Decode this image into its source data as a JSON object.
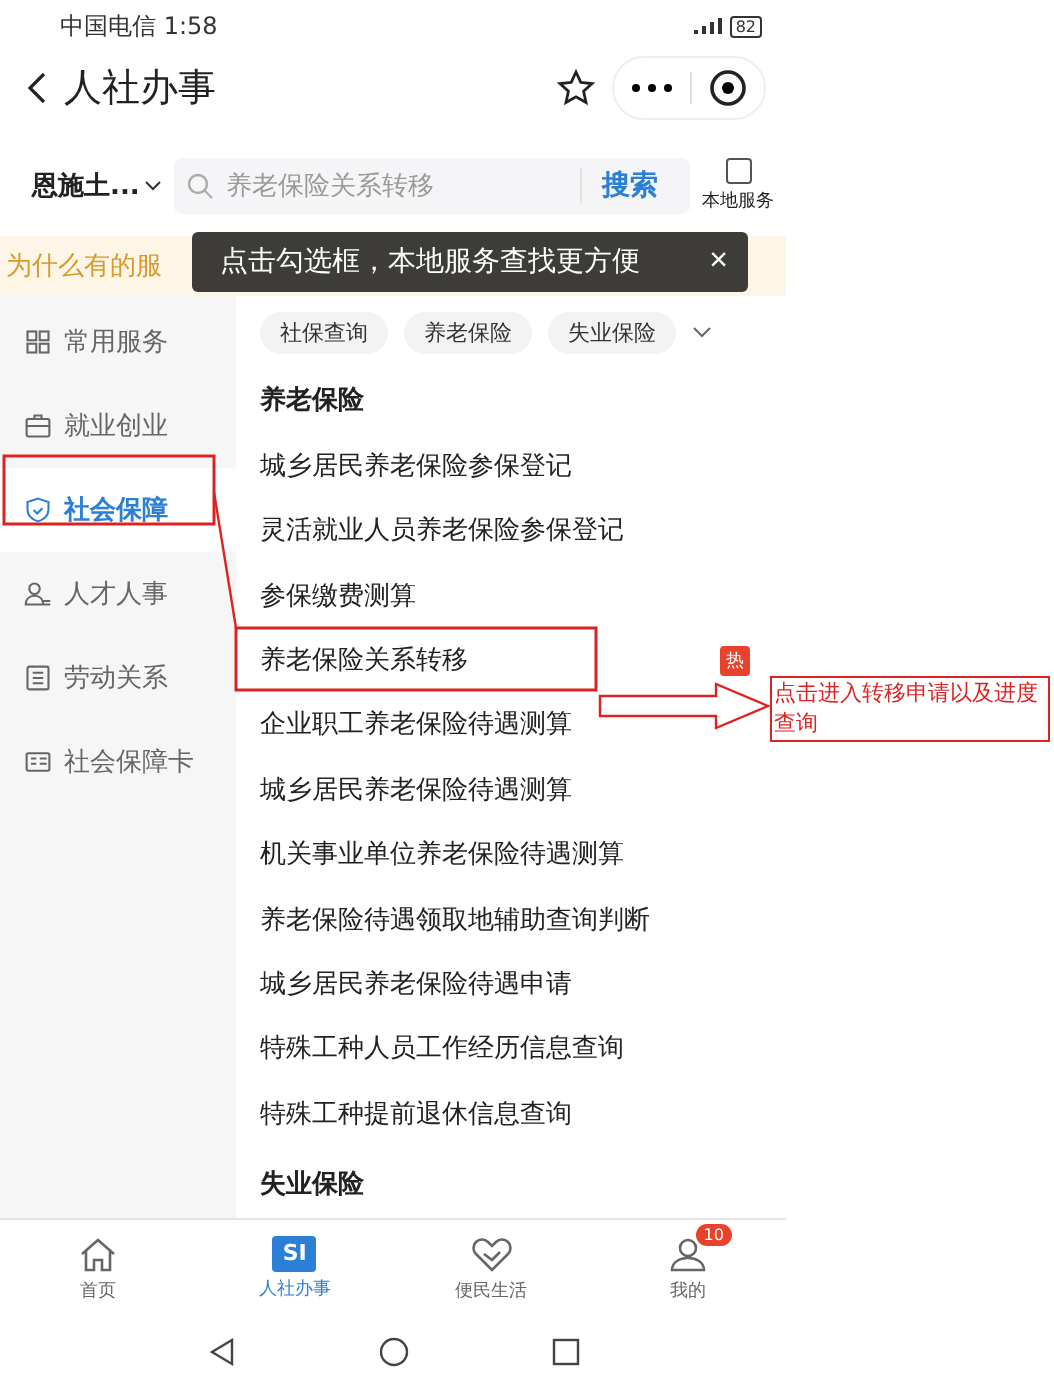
{
  "status_bar": {
    "carrier": "中国电信",
    "time": "1:58",
    "battery": "82"
  },
  "nav": {
    "title": "人社办事"
  },
  "search": {
    "region": "恩施土...",
    "placeholder": "养老保险关系转移",
    "button": "搜索",
    "local_service": {
      "label": "本地服务",
      "checked": false
    }
  },
  "banner": {
    "text": "为什么有的服"
  },
  "tooltip": {
    "text": "点击勾选框，本地服务查找更方便",
    "close": "×"
  },
  "sidebar": {
    "items": [
      {
        "label": "常用服务",
        "selected": false
      },
      {
        "label": "就业创业",
        "selected": false
      },
      {
        "label": "社会保障",
        "selected": true
      },
      {
        "label": "人才人事",
        "selected": false
      },
      {
        "label": "劳动关系",
        "selected": false
      },
      {
        "label": "社会保障卡",
        "selected": false
      }
    ]
  },
  "chips": [
    "社保查询",
    "养老保险",
    "失业保险"
  ],
  "sections": [
    {
      "title": "养老保险",
      "items": [
        {
          "label": "城乡居民养老保险参保登记"
        },
        {
          "label": "灵活就业人员养老保险参保登记"
        },
        {
          "label": "参保缴费测算"
        },
        {
          "label": "养老保险关系转移",
          "badge": "热"
        },
        {
          "label": "企业职工养老保险待遇测算"
        },
        {
          "label": "城乡居民养老保险待遇测算"
        },
        {
          "label": "机关事业单位养老保险待遇测算"
        },
        {
          "label": "养老保险待遇领取地辅助查询判断"
        },
        {
          "label": "城乡居民养老保险待遇申请"
        },
        {
          "label": "特殊工种人员工作经历信息查询"
        },
        {
          "label": "特殊工种提前退休信息查询"
        }
      ]
    },
    {
      "title": "失业保险"
    }
  ],
  "tabbar": [
    {
      "label": "首页",
      "selected": false
    },
    {
      "label": "人社办事",
      "selected": true,
      "logo": "SI"
    },
    {
      "label": "便民生活",
      "selected": false
    },
    {
      "label": "我的",
      "selected": false,
      "badge": "10"
    }
  ],
  "annotation": {
    "text": "点击进入转移申请以及进度查询"
  }
}
